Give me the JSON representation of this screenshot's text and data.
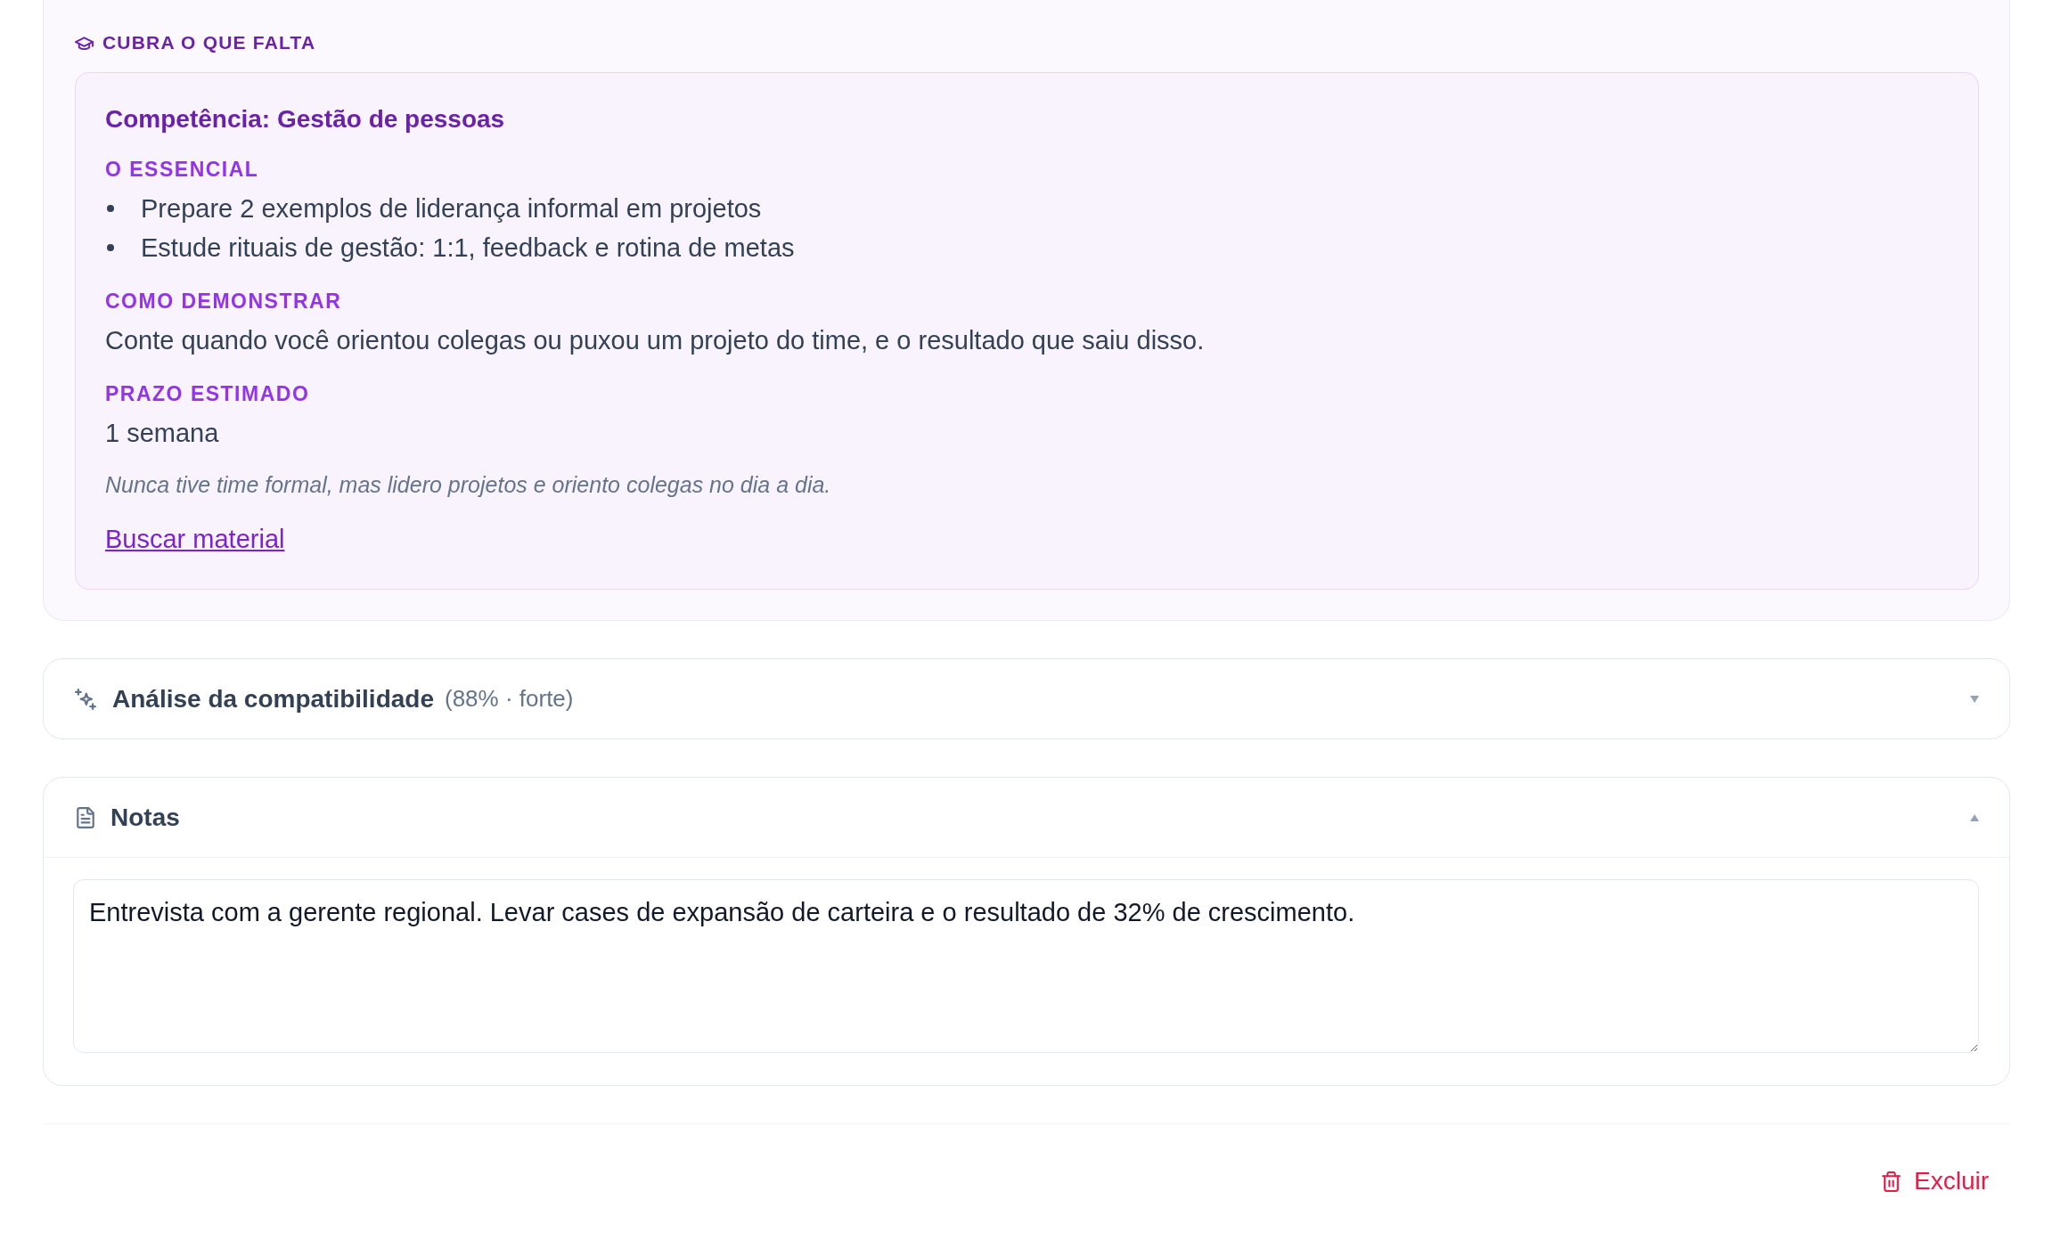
{
  "gap_panel": {
    "heading": "CUBRA O QUE FALTA",
    "items": [
      {
        "title": "Competência: Gestão de pessoas",
        "blocks": [
          {
            "kind": "list",
            "label": "O ESSENCIAL",
            "items": [
              "Prepare 2 exemplos de liderança informal em projetos",
              "Estude rituais de gestão: 1:1, feedback e rotina de metas"
            ]
          },
          {
            "kind": "text",
            "label": "COMO DEMONSTRAR",
            "text": "Conte quando você orientou colegas ou puxou um projeto do time, e o resultado que saiu disso."
          },
          {
            "kind": "text",
            "label": "PRAZO ESTIMADO",
            "text": "1 semana"
          }
        ],
        "note": "Nunca tive time formal, mas lidero projetos e oriento colegas no dia a dia.",
        "link": "Buscar material"
      }
    ]
  },
  "sections": [
    {
      "kind": "analysis",
      "title": "Análise da compatibilidade",
      "summary": "(88% · forte)",
      "expanded": false
    },
    {
      "kind": "notes",
      "title": "Notas",
      "expanded": true,
      "value": "Entrevista com a gerente regional. Levar cases de expansão de carteira e o resultado de 32% de crescimento."
    }
  ],
  "delete_button": "Excluir"
}
